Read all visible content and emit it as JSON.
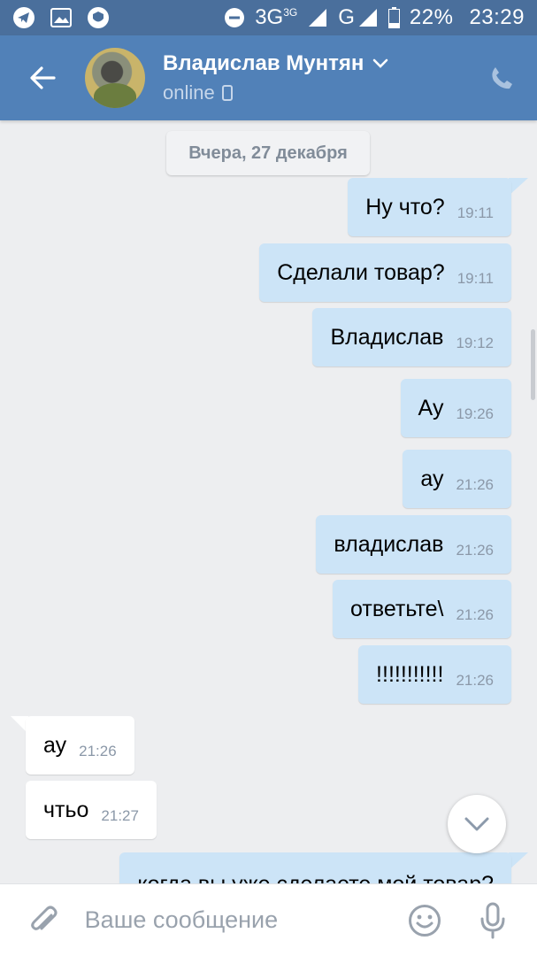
{
  "status_bar": {
    "network": "3G",
    "network_small": "3G",
    "network2": "G",
    "battery": "22%",
    "time": "23:29",
    "icons": [
      "telegram-icon",
      "gallery-icon",
      "shield-icon",
      "dnd-icon",
      "signal-icon",
      "battery-icon"
    ]
  },
  "header": {
    "name": "Владислав Мунтян",
    "status": "online",
    "colors": {
      "bar": "#5181b8",
      "status": "#c6d6ea"
    }
  },
  "chat": {
    "date_label": "Вчера, 27 декабря",
    "messages": [
      {
        "direction": "out",
        "text": "Ну что?",
        "time": "19:11"
      },
      {
        "direction": "out",
        "text": "Сделали товар?",
        "time": "19:11"
      },
      {
        "direction": "out",
        "text": "Владислав",
        "time": "19:12"
      },
      {
        "direction": "out",
        "text": "Ау",
        "time": "19:26"
      },
      {
        "direction": "out",
        "text": "ау",
        "time": "21:26"
      },
      {
        "direction": "out",
        "text": "владислав",
        "time": "21:26"
      },
      {
        "direction": "out",
        "text": "ответьте\\",
        "time": "21:26"
      },
      {
        "direction": "out",
        "text": "!!!!!!!!!!!",
        "time": "21:26"
      },
      {
        "direction": "in",
        "text": "ау",
        "time": "21:26"
      },
      {
        "direction": "in",
        "text": "чтьо",
        "time": "21:27"
      },
      {
        "direction": "out",
        "text": "когда вы уже сделаете мой товар?",
        "time": ""
      }
    ],
    "colors": {
      "outgoing": "#cce4f7",
      "incoming": "#ffffff",
      "background": "#edeef0"
    }
  },
  "composer": {
    "placeholder": "Ваше сообщение"
  }
}
